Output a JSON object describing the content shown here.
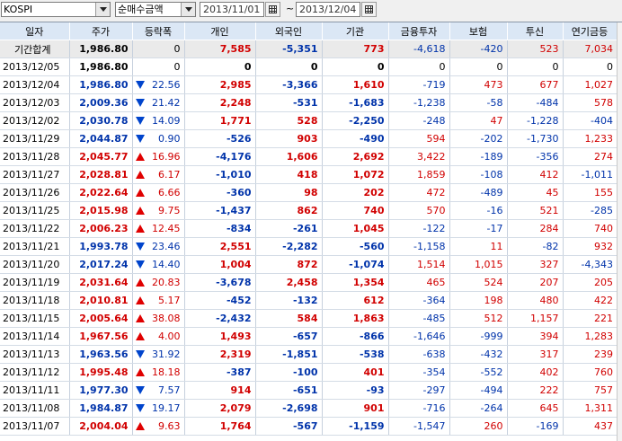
{
  "toolbar": {
    "market": "KOSPI",
    "metric": "순매수금액",
    "start_date": "2013/11/01",
    "separator": "~",
    "end_date": "2013/12/04"
  },
  "columns": [
    "일자",
    "주가",
    "등락폭",
    "개인",
    "외국인",
    "기관",
    "금융투자",
    "보험",
    "투신",
    "연기금등"
  ],
  "total_row": {
    "date": "기간합계",
    "price": "1,986.80",
    "change": "0",
    "individual": "7,585",
    "foreign": "-5,351",
    "institution": "773",
    "fin": "-4,618",
    "insurance": "-420",
    "trust": "523",
    "pension": "7,034"
  },
  "rows": [
    {
      "date": "2013/12/05",
      "price": "1,986.80",
      "change": "0",
      "dir": "",
      "individual": "0",
      "foreign": "0",
      "institution": "0",
      "fin": "0",
      "insurance": "0",
      "trust": "0",
      "pension": "0"
    },
    {
      "date": "2013/12/04",
      "price": "1,986.80",
      "change": "22.56",
      "dir": "down",
      "individual": "2,985",
      "foreign": "-3,366",
      "institution": "1,610",
      "fin": "-719",
      "insurance": "473",
      "trust": "677",
      "pension": "1,027"
    },
    {
      "date": "2013/12/03",
      "price": "2,009.36",
      "change": "21.42",
      "dir": "down",
      "individual": "2,248",
      "foreign": "-531",
      "institution": "-1,683",
      "fin": "-1,238",
      "insurance": "-58",
      "trust": "-484",
      "pension": "578"
    },
    {
      "date": "2013/12/02",
      "price": "2,030.78",
      "change": "14.09",
      "dir": "down",
      "individual": "1,771",
      "foreign": "528",
      "institution": "-2,250",
      "fin": "-248",
      "insurance": "47",
      "trust": "-1,228",
      "pension": "-404"
    },
    {
      "date": "2013/11/29",
      "price": "2,044.87",
      "change": "0.90",
      "dir": "down",
      "individual": "-526",
      "foreign": "903",
      "institution": "-490",
      "fin": "594",
      "insurance": "-202",
      "trust": "-1,730",
      "pension": "1,233"
    },
    {
      "date": "2013/11/28",
      "price": "2,045.77",
      "change": "16.96",
      "dir": "up",
      "individual": "-4,176",
      "foreign": "1,606",
      "institution": "2,692",
      "fin": "3,422",
      "insurance": "-189",
      "trust": "-356",
      "pension": "274"
    },
    {
      "date": "2013/11/27",
      "price": "2,028.81",
      "change": "6.17",
      "dir": "up",
      "individual": "-1,010",
      "foreign": "418",
      "institution": "1,072",
      "fin": "1,859",
      "insurance": "-108",
      "trust": "412",
      "pension": "-1,011"
    },
    {
      "date": "2013/11/26",
      "price": "2,022.64",
      "change": "6.66",
      "dir": "up",
      "individual": "-360",
      "foreign": "98",
      "institution": "202",
      "fin": "472",
      "insurance": "-489",
      "trust": "45",
      "pension": "155"
    },
    {
      "date": "2013/11/25",
      "price": "2,015.98",
      "change": "9.75",
      "dir": "up",
      "individual": "-1,437",
      "foreign": "862",
      "institution": "740",
      "fin": "570",
      "insurance": "-16",
      "trust": "521",
      "pension": "-285"
    },
    {
      "date": "2013/11/22",
      "price": "2,006.23",
      "change": "12.45",
      "dir": "up",
      "individual": "-834",
      "foreign": "-261",
      "institution": "1,045",
      "fin": "-122",
      "insurance": "-17",
      "trust": "284",
      "pension": "740"
    },
    {
      "date": "2013/11/21",
      "price": "1,993.78",
      "change": "23.46",
      "dir": "down",
      "individual": "2,551",
      "foreign": "-2,282",
      "institution": "-560",
      "fin": "-1,158",
      "insurance": "11",
      "trust": "-82",
      "pension": "932"
    },
    {
      "date": "2013/11/20",
      "price": "2,017.24",
      "change": "14.40",
      "dir": "down",
      "individual": "1,004",
      "foreign": "872",
      "institution": "-1,074",
      "fin": "1,514",
      "insurance": "1,015",
      "trust": "327",
      "pension": "-4,343"
    },
    {
      "date": "2013/11/19",
      "price": "2,031.64",
      "change": "20.83",
      "dir": "up",
      "individual": "-3,678",
      "foreign": "2,458",
      "institution": "1,354",
      "fin": "465",
      "insurance": "524",
      "trust": "207",
      "pension": "205"
    },
    {
      "date": "2013/11/18",
      "price": "2,010.81",
      "change": "5.17",
      "dir": "up",
      "individual": "-452",
      "foreign": "-132",
      "institution": "612",
      "fin": "-364",
      "insurance": "198",
      "trust": "480",
      "pension": "422"
    },
    {
      "date": "2013/11/15",
      "price": "2,005.64",
      "change": "38.08",
      "dir": "up",
      "individual": "-2,432",
      "foreign": "584",
      "institution": "1,863",
      "fin": "-485",
      "insurance": "512",
      "trust": "1,157",
      "pension": "221"
    },
    {
      "date": "2013/11/14",
      "price": "1,967.56",
      "change": "4.00",
      "dir": "up",
      "individual": "1,493",
      "foreign": "-657",
      "institution": "-866",
      "fin": "-1,646",
      "insurance": "-999",
      "trust": "394",
      "pension": "1,283"
    },
    {
      "date": "2013/11/13",
      "price": "1,963.56",
      "change": "31.92",
      "dir": "down",
      "individual": "2,319",
      "foreign": "-1,851",
      "institution": "-538",
      "fin": "-638",
      "insurance": "-432",
      "trust": "317",
      "pension": "239"
    },
    {
      "date": "2013/11/12",
      "price": "1,995.48",
      "change": "18.18",
      "dir": "up",
      "individual": "-387",
      "foreign": "-100",
      "institution": "401",
      "fin": "-354",
      "insurance": "-552",
      "trust": "402",
      "pension": "760"
    },
    {
      "date": "2013/11/11",
      "price": "1,977.30",
      "change": "7.57",
      "dir": "down",
      "individual": "914",
      "foreign": "-651",
      "institution": "-93",
      "fin": "-297",
      "insurance": "-494",
      "trust": "222",
      "pension": "757"
    },
    {
      "date": "2013/11/08",
      "price": "1,984.87",
      "change": "19.17",
      "dir": "down",
      "individual": "2,079",
      "foreign": "-2,698",
      "institution": "901",
      "fin": "-716",
      "insurance": "-264",
      "trust": "645",
      "pension": "1,311"
    },
    {
      "date": "2013/11/07",
      "price": "2,004.04",
      "change": "9.63",
      "dir": "up",
      "individual": "1,764",
      "foreign": "-567",
      "institution": "-1,159",
      "fin": "-1,547",
      "insurance": "260",
      "trust": "-169",
      "pension": "437"
    }
  ],
  "colors": {
    "up": "#d10000",
    "down": "#0033aa",
    "header_bg": "#dbe7f5"
  }
}
